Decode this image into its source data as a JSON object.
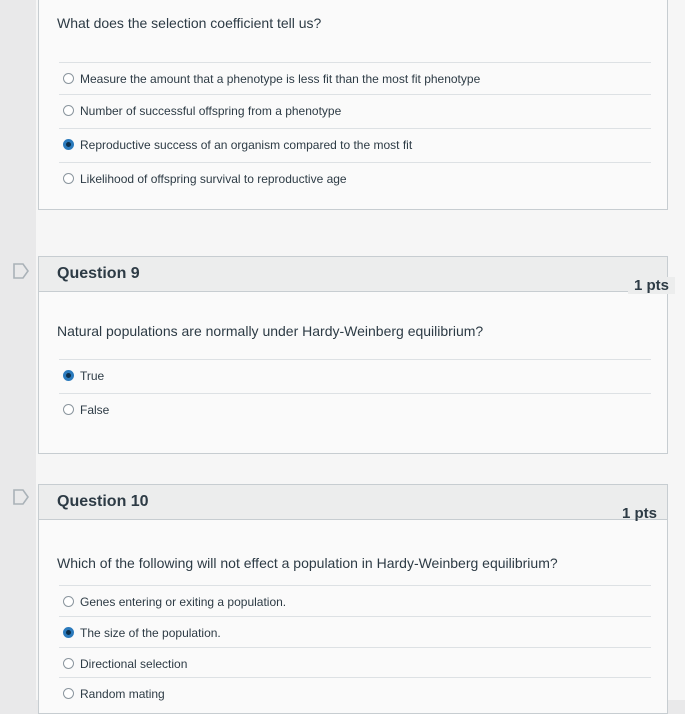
{
  "q8": {
    "text": "What does the selection coefficient tell us?",
    "answers": [
      {
        "label": "Measure the amount that a phenotype is less fit than the most fit phenotype",
        "selected": false
      },
      {
        "label": "Number of successful offspring from a phenotype",
        "selected": false
      },
      {
        "label": "Reproductive success of an organism compared to the most fit",
        "selected": true
      },
      {
        "label": "Likelihood of offspring survival to reproductive age",
        "selected": false
      }
    ]
  },
  "q9": {
    "title": "Question 9",
    "points": "1 pts",
    "text": "Natural populations are normally under Hardy-Weinberg equilibrium?",
    "answers": [
      {
        "label": "True",
        "selected": true
      },
      {
        "label": "False",
        "selected": false
      }
    ]
  },
  "q10": {
    "title": "Question 10",
    "points": "1 pts",
    "text": "Which of the following will not effect a population in Hardy-Weinberg equilibrium?",
    "answers": [
      {
        "label": "Genes entering or exiting a population.",
        "selected": false
      },
      {
        "label": "The size of the population.",
        "selected": true
      },
      {
        "label": "Directional selection",
        "selected": false
      },
      {
        "label": "Random mating",
        "selected": false
      }
    ]
  },
  "icons": {
    "flag": "bookmark-flag-icon",
    "radio": "radio-button-icon"
  },
  "colors": {
    "accent": "#2b7abc",
    "header_bg": "#eceded",
    "flag": "#c7cdd1"
  }
}
